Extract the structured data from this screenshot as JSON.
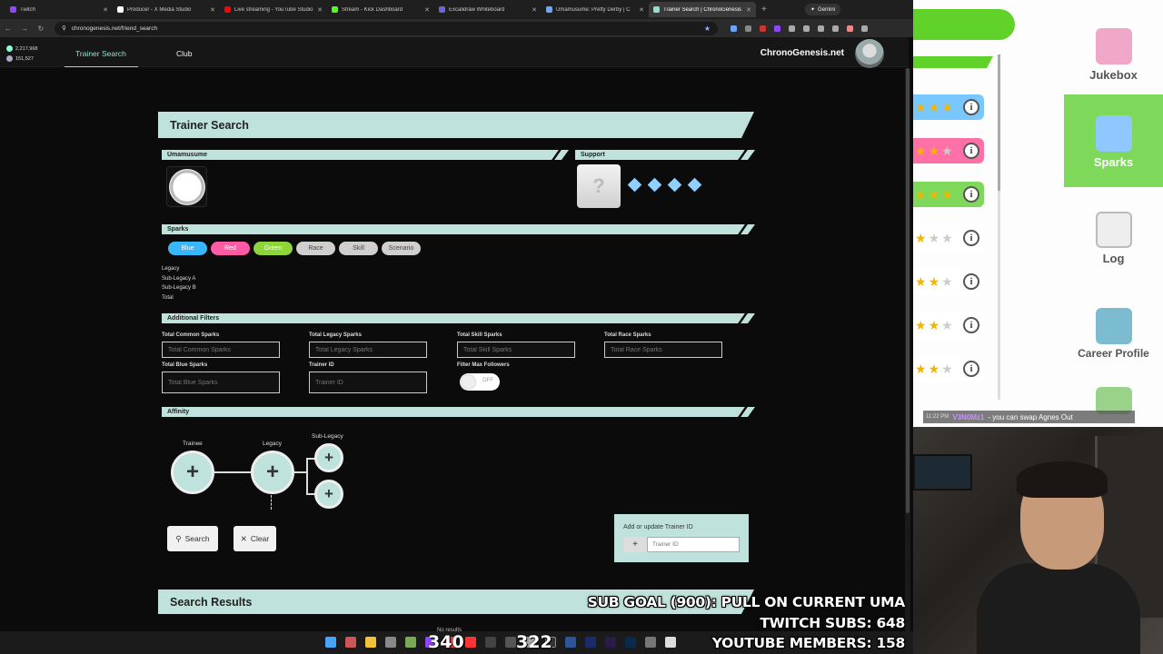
{
  "browser": {
    "tabs": [
      {
        "label": "Twitch",
        "color": "#9146ff"
      },
      {
        "label": "Producer - X Media Studio",
        "color": "#ffffff"
      },
      {
        "label": "Live streaming - YouTube Studio",
        "color": "#ff0000"
      },
      {
        "label": "Stream - Kick Dashboard",
        "color": "#53fc18"
      },
      {
        "label": "Excalidraw Whiteboard",
        "color": "#6965db"
      },
      {
        "label": "Umamusume: Pretty Derby | C",
        "color": "#6aa6ff"
      },
      {
        "label": "Trainer Search | ChronoGenesis",
        "color": "#8ee0d0",
        "active": true
      }
    ],
    "gemini_label": "Gemini",
    "url": "chronogenesis.net/friend_search"
  },
  "site": {
    "stat_1": "2,217,968",
    "stat_2": "151,527",
    "nav": [
      {
        "label": "Trainer Search",
        "active": true
      },
      {
        "label": "Club",
        "active": false
      }
    ],
    "brand": "ChronoGenesis.net"
  },
  "trainer_search": {
    "title": "Trainer Search",
    "umamusume_label": "Umamusume",
    "support_label": "Support",
    "support_placeholder": "?",
    "sparks_label": "Sparks",
    "spark_buttons": [
      "Blue",
      "Red",
      "Green",
      "Race",
      "Skill",
      "Scenario"
    ],
    "legacy_rows": [
      "Legacy",
      "Sub-Legacy A",
      "Sub-Legacy B",
      "Total"
    ],
    "additional_filters_label": "Additional Filters",
    "filters": {
      "total_common": {
        "label": "Total Common Sparks",
        "placeholder": "Total Common Sparks"
      },
      "total_legacy": {
        "label": "Total Legacy Sparks",
        "placeholder": "Total Legacy Sparks"
      },
      "total_skill": {
        "label": "Total Skill Sparks",
        "placeholder": "Total Skill Sparks"
      },
      "total_race": {
        "label": "Total Race Sparks",
        "placeholder": "Total Race Sparks"
      },
      "total_blue": {
        "label": "Total Blue Sparks",
        "placeholder": "Total Blue Sparks"
      },
      "trainer_id": {
        "label": "Trainer ID",
        "placeholder": "Trainer ID"
      },
      "max_followers": {
        "label": "Filter Max Followers",
        "state": "OFF"
      }
    },
    "affinity_label": "Affinity",
    "affinity": {
      "trainee": "Trainee",
      "legacy": "Legacy",
      "sub_legacy": "Sub-Legacy"
    },
    "search_button": "Search",
    "clear_button": "Clear",
    "add_trainer": {
      "title": "Add or update Trainer ID",
      "placeholder": "Trainer ID"
    },
    "results_title": "Search Results",
    "no_results": "No results"
  },
  "game": {
    "side_items": [
      {
        "label": "Jukebox",
        "selected": false
      },
      {
        "label": "Sparks",
        "selected": true
      },
      {
        "label": "Log",
        "selected": false
      },
      {
        "label": "Career Profile",
        "selected": false
      }
    ],
    "star_rows": [
      {
        "stars": 3,
        "color": "#78c8ff"
      },
      {
        "stars": 2,
        "color": "#ff6fa8"
      },
      {
        "stars": 3,
        "color": "#7ed85a"
      },
      {
        "stars": 1,
        "color": "#ffffff"
      },
      {
        "stars": 2,
        "color": "#ffffff"
      },
      {
        "stars": 2,
        "color": "#ffffff"
      },
      {
        "stars": 2,
        "color": "#ffffff"
      }
    ]
  },
  "chat": {
    "time": "11:22 PM",
    "user": "V3N0Mz1",
    "message": "- you can swap Agnes Out"
  },
  "overlay": {
    "sub_goal": "SUB GOAL (900): PULL ON CURRENT UMA",
    "twitch_subs": "TWITCH SUBS: 648",
    "youtube_members": "YOUTUBE MEMBERS: 158",
    "count_a": "340",
    "count_b": "322"
  }
}
